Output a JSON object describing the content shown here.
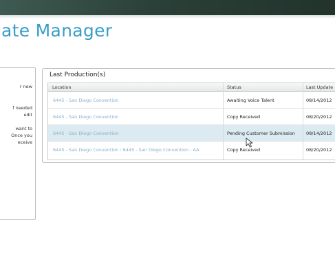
{
  "header": {
    "title": "ate Manager"
  },
  "sidebar": {
    "lines": [
      "r new",
      "f needed",
      "edit",
      "want to",
      "Once you",
      "eceive"
    ]
  },
  "productions": {
    "title": "Last Production(s)",
    "columns": [
      "Location",
      "Status",
      "Last Update"
    ],
    "rows": [
      {
        "location": "6445 - San Diego Convention",
        "status": "Awaiting Voice Talent",
        "date": "08/14/2012"
      },
      {
        "location": "6445 - San Diego Convention",
        "status": "Copy Received",
        "date": "08/20/2012"
      },
      {
        "location": "6445 - San Diego Convention",
        "status": "Pending Customer Submission",
        "date": "08/14/2012"
      },
      {
        "location": "6445 - San Diego Convention : 6445 - San Diego Convention - AA",
        "status": "Copy Received",
        "date": "08/20/2012"
      }
    ]
  },
  "colors": {
    "title": "#3a9dc9",
    "link": "#8aaecb",
    "selected_row": "#dceaf1",
    "top_bar": "#2b4038"
  }
}
